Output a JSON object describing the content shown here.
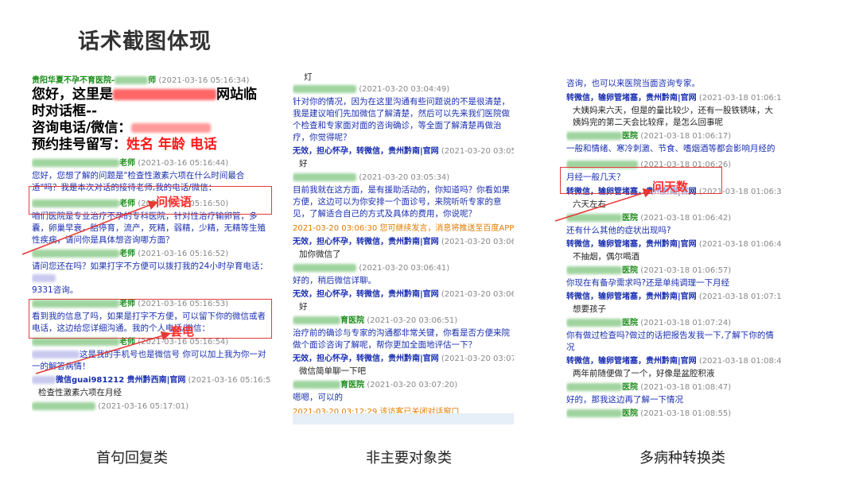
{
  "title": "话术截图体现",
  "captions": [
    "首句回复类",
    "非主要对象类",
    "多病种转换类"
  ],
  "panel1": {
    "header_name": "贵阳华夏不孕不育医院-",
    "header_suffix": "师",
    "header_time": "(2021-03-16 05:16:34)",
    "greet_line1a": "您好，这里是",
    "greet_line1b": "网站临",
    "greet_line2": "时对话框--",
    "greet_line3": "咨询电话/微信：",
    "greet_line4a": "预约挂号留写：",
    "greet_line4b": "姓名 年龄 电话",
    "m1_name": "老师",
    "m1_time": "(2021-03-16 05:16:44)",
    "m1_text": "您好，您想了解的问题是\"检查性激素六项在什么时间最合适\"吗？我是本次对话的接待老师,我的电话/微信：",
    "m2_name": "老师",
    "m2_time": "(2021-03-16 05:16:50)",
    "m2_text": "咱们医院是专业治疗不孕的专科医院，针对性治疗输卵管，多囊，卵巢早衰，胎停育，流产，死精，弱精，少精，无精等生殖性疾病，请问你是具体想咨询哪方面？",
    "m3_name": "老师",
    "m3_time": "(2021-03-16 05:16:52)",
    "m3_text_a": "请问您还在吗？如果打字不方便可以拨打我的24小时孕育电话：",
    "m3_text_b": "9331咨询。",
    "m4_name": "老师",
    "m4_time": "(2021-03-16 05:16:53)",
    "m4_text": "看到我的信息了吗，如果是打字不方便，可以留下你的微信或者电话，这边给您详细沟通。我的个人电话/微信：",
    "m5_name": "老师",
    "m5_time": "(2021-03-16 05:16:54)",
    "m5_text": "这是我的手机号也是微信号 你可以加上我为你一对一的解答病情！",
    "u1_name": "微信guai981212 贵州黔西南|官网",
    "u1_time": "(2021-03-16 05:16:56)",
    "u1_text": "检查性激素六项在月经",
    "m6_time": "(2021-03-16 05:17:01)",
    "annot1": "问候语",
    "annot2": "套电"
  },
  "panel2": {
    "top_text": "灯",
    "a1_time": "(2021-03-20 03:04:49)",
    "a1_text": "针对你的情况，因为在这里沟通有些问题说的不是很清楚，我是建议咱们先加微信了解清楚，然后可以先来我们医院做个检查和专家面对面的咨询确诊，等全面了解清楚再做治疗，你觉得呢？",
    "u1_name": "无效，担心怀孕，转微信，贵州黔南|官网",
    "u1_time": "(2021-03-20 03:05:28)",
    "u1_text": "好",
    "a2_time": "(2021-03-20 03:05:34)",
    "a2_text": "目前我就在这方面，是有援助活动的，你知道吗？你看如果方便，这边可以为你安排一个面诊号，来院听听专家的意见，了解适合自己的方式及具体的费用，你说呢？",
    "sys1": "2021-03-20 03:06:30 您可继续发言，消息将推送至百度APP-消息中心",
    "u2_name": "无效，担心怀孕，转微信，贵州黔南|官网",
    "u2_time": "(2021-03-20 03:06:36)",
    "u2_text": "加你微信了",
    "a3_time": "(2021-03-20 03:06:41)",
    "a3_text": "好的，稍后微信详聊。",
    "u3_name": "无效，担心怀孕，转微信，贵州黔南|官网",
    "u3_time": "(2021-03-20 03:06:46)",
    "u3_text": "好",
    "a4_name": "育医院",
    "a4_time": "(2021-03-20 03:06:51)",
    "a4_text": "治疗前的确诊与专家的沟通都非常关键，你看是否方便来院做个面诊咨询了解呢，帮你更加全面地评估一下？",
    "u4_name": "无效，担心怀孕，转微信，贵州黔南|官网",
    "u4_time": "(2021-03-20 03:07:15)",
    "u4_text": "微信简单聊一下吧",
    "a5_name": "育医院",
    "a5_time": "(2021-03-20 03:07:20)",
    "a5_text": "嗯嗯，可以的",
    "sys2": "2021-03-20 03:12:29 该访客已关闭对话窗口"
  },
  "panel3": {
    "top_text": "咨询，也可以来医院当面咨询专家。",
    "u1_name": "转微信，输卵管堵塞，贵州黔南|官网",
    "u1_time": "(2021-03-18 01:06:12)",
    "u1_text": "大姨妈来六天，但是的量比较少，还有一股铁锈味，大姨妈完的第二天会比较痒，是怎么回事呢",
    "a1_name": "医院",
    "a1_time": "(2021-03-18 01:06:17)",
    "a1_text": "一般和情绪、寒冷刺激、节食、嗜烟酒等都会影响月经的",
    "a2_time": "(2021-03-18 01:06:26)",
    "a2_text": "月经一般几天？",
    "u2_name": "转微信，输卵管堵塞，贵州黔南|官网",
    "u2_time": "(2021-03-18 01:06:34)",
    "u2_text": "六天左右",
    "a3_name": "医院",
    "a3_time": "(2021-03-18 01:06:42)",
    "a3_text": "还有什么其他的症状出现吗?",
    "u3_name": "转微信，输卵管堵塞，贵州黔南|官网",
    "u3_time": "(2021-03-18 01:06:49)",
    "u3_text": "不抽烟，偶尔喝酒",
    "a4_name": "医院",
    "a4_time": "(2021-03-18 01:06:57)",
    "a4_text": "你现在有备孕需求吗?还是单纯调理一下月经",
    "u4_name": "转微信，输卵管堵塞，贵州黔南|官网",
    "u4_time": "(2021-03-18 01:07:16)",
    "u4_text": "想要孩子",
    "a5_name": "医院",
    "a5_time": "(2021-03-18 01:07:24)",
    "a5_text": "你有做过检查吗?做过的话把报告发我一下,了解下你的情况",
    "u5_name": "转微信，输卵管堵塞，贵州黔南|官网",
    "u5_time": "(2021-03-18 01:08:42)",
    "u5_text": "两年前随便做了一个，好像是盆腔积液",
    "a6_name": "医院",
    "a6_time": "(2021-03-18 01:08:47)",
    "a6_text": "好的，那我这边再了解一下情况",
    "a7_name": "医院",
    "a7_time": "(2021-03-18 01:08:55)",
    "annot": "问天数"
  }
}
